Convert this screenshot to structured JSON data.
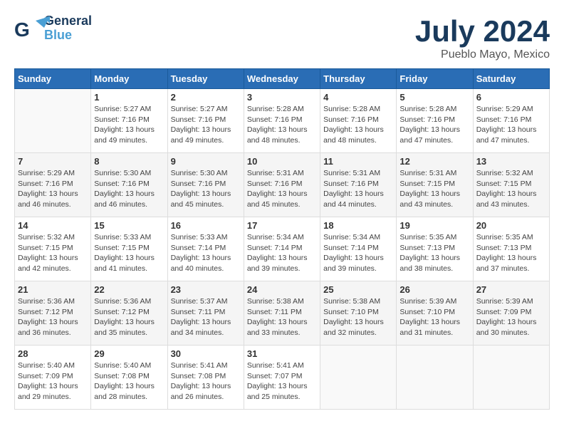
{
  "header": {
    "logo_line1": "General",
    "logo_line2": "Blue",
    "month": "July 2024",
    "location": "Pueblo Mayo, Mexico"
  },
  "days_of_week": [
    "Sunday",
    "Monday",
    "Tuesday",
    "Wednesday",
    "Thursday",
    "Friday",
    "Saturday"
  ],
  "weeks": [
    [
      {
        "day": "",
        "info": ""
      },
      {
        "day": "1",
        "info": "Sunrise: 5:27 AM\nSunset: 7:16 PM\nDaylight: 13 hours\nand 49 minutes."
      },
      {
        "day": "2",
        "info": "Sunrise: 5:27 AM\nSunset: 7:16 PM\nDaylight: 13 hours\nand 49 minutes."
      },
      {
        "day": "3",
        "info": "Sunrise: 5:28 AM\nSunset: 7:16 PM\nDaylight: 13 hours\nand 48 minutes."
      },
      {
        "day": "4",
        "info": "Sunrise: 5:28 AM\nSunset: 7:16 PM\nDaylight: 13 hours\nand 48 minutes."
      },
      {
        "day": "5",
        "info": "Sunrise: 5:28 AM\nSunset: 7:16 PM\nDaylight: 13 hours\nand 47 minutes."
      },
      {
        "day": "6",
        "info": "Sunrise: 5:29 AM\nSunset: 7:16 PM\nDaylight: 13 hours\nand 47 minutes."
      }
    ],
    [
      {
        "day": "7",
        "info": "Sunrise: 5:29 AM\nSunset: 7:16 PM\nDaylight: 13 hours\nand 46 minutes."
      },
      {
        "day": "8",
        "info": "Sunrise: 5:30 AM\nSunset: 7:16 PM\nDaylight: 13 hours\nand 46 minutes."
      },
      {
        "day": "9",
        "info": "Sunrise: 5:30 AM\nSunset: 7:16 PM\nDaylight: 13 hours\nand 45 minutes."
      },
      {
        "day": "10",
        "info": "Sunrise: 5:31 AM\nSunset: 7:16 PM\nDaylight: 13 hours\nand 45 minutes."
      },
      {
        "day": "11",
        "info": "Sunrise: 5:31 AM\nSunset: 7:16 PM\nDaylight: 13 hours\nand 44 minutes."
      },
      {
        "day": "12",
        "info": "Sunrise: 5:31 AM\nSunset: 7:15 PM\nDaylight: 13 hours\nand 43 minutes."
      },
      {
        "day": "13",
        "info": "Sunrise: 5:32 AM\nSunset: 7:15 PM\nDaylight: 13 hours\nand 43 minutes."
      }
    ],
    [
      {
        "day": "14",
        "info": "Sunrise: 5:32 AM\nSunset: 7:15 PM\nDaylight: 13 hours\nand 42 minutes."
      },
      {
        "day": "15",
        "info": "Sunrise: 5:33 AM\nSunset: 7:15 PM\nDaylight: 13 hours\nand 41 minutes."
      },
      {
        "day": "16",
        "info": "Sunrise: 5:33 AM\nSunset: 7:14 PM\nDaylight: 13 hours\nand 40 minutes."
      },
      {
        "day": "17",
        "info": "Sunrise: 5:34 AM\nSunset: 7:14 PM\nDaylight: 13 hours\nand 39 minutes."
      },
      {
        "day": "18",
        "info": "Sunrise: 5:34 AM\nSunset: 7:14 PM\nDaylight: 13 hours\nand 39 minutes."
      },
      {
        "day": "19",
        "info": "Sunrise: 5:35 AM\nSunset: 7:13 PM\nDaylight: 13 hours\nand 38 minutes."
      },
      {
        "day": "20",
        "info": "Sunrise: 5:35 AM\nSunset: 7:13 PM\nDaylight: 13 hours\nand 37 minutes."
      }
    ],
    [
      {
        "day": "21",
        "info": "Sunrise: 5:36 AM\nSunset: 7:12 PM\nDaylight: 13 hours\nand 36 minutes."
      },
      {
        "day": "22",
        "info": "Sunrise: 5:36 AM\nSunset: 7:12 PM\nDaylight: 13 hours\nand 35 minutes."
      },
      {
        "day": "23",
        "info": "Sunrise: 5:37 AM\nSunset: 7:11 PM\nDaylight: 13 hours\nand 34 minutes."
      },
      {
        "day": "24",
        "info": "Sunrise: 5:38 AM\nSunset: 7:11 PM\nDaylight: 13 hours\nand 33 minutes."
      },
      {
        "day": "25",
        "info": "Sunrise: 5:38 AM\nSunset: 7:10 PM\nDaylight: 13 hours\nand 32 minutes."
      },
      {
        "day": "26",
        "info": "Sunrise: 5:39 AM\nSunset: 7:10 PM\nDaylight: 13 hours\nand 31 minutes."
      },
      {
        "day": "27",
        "info": "Sunrise: 5:39 AM\nSunset: 7:09 PM\nDaylight: 13 hours\nand 30 minutes."
      }
    ],
    [
      {
        "day": "28",
        "info": "Sunrise: 5:40 AM\nSunset: 7:09 PM\nDaylight: 13 hours\nand 29 minutes."
      },
      {
        "day": "29",
        "info": "Sunrise: 5:40 AM\nSunset: 7:08 PM\nDaylight: 13 hours\nand 28 minutes."
      },
      {
        "day": "30",
        "info": "Sunrise: 5:41 AM\nSunset: 7:08 PM\nDaylight: 13 hours\nand 26 minutes."
      },
      {
        "day": "31",
        "info": "Sunrise: 5:41 AM\nSunset: 7:07 PM\nDaylight: 13 hours\nand 25 minutes."
      },
      {
        "day": "",
        "info": ""
      },
      {
        "day": "",
        "info": ""
      },
      {
        "day": "",
        "info": ""
      }
    ]
  ]
}
